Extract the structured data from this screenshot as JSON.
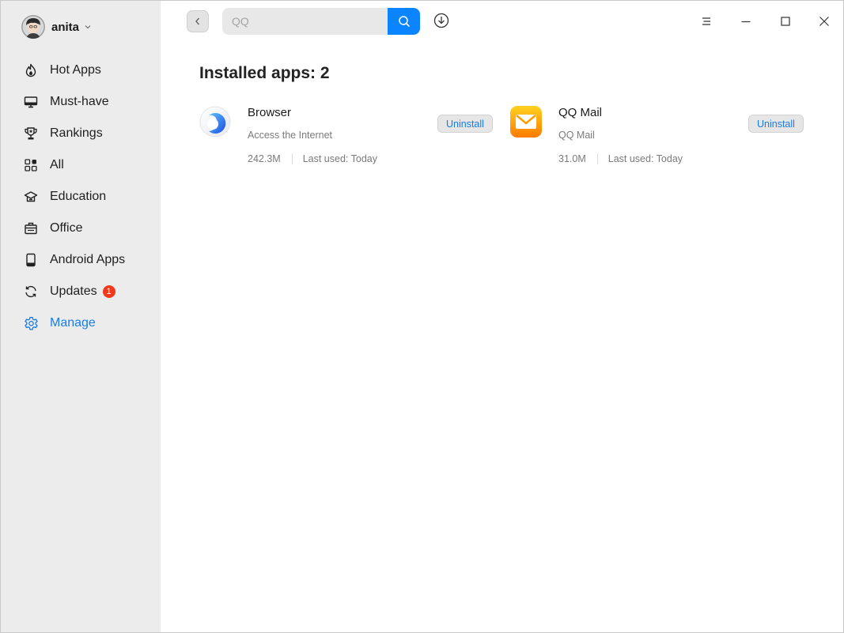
{
  "user": {
    "name": "anita"
  },
  "sidebar": {
    "items": [
      {
        "label": "Hot Apps",
        "icon": "flame-icon"
      },
      {
        "label": "Must-have",
        "icon": "monitor-icon"
      },
      {
        "label": "Rankings",
        "icon": "trophy-icon"
      },
      {
        "label": "All",
        "icon": "grid-icon"
      },
      {
        "label": "Education",
        "icon": "graduation-cap-icon"
      },
      {
        "label": "Office",
        "icon": "briefcase-icon"
      },
      {
        "label": "Android Apps",
        "icon": "phone-icon"
      },
      {
        "label": "Updates",
        "icon": "refresh-icon",
        "badge": "1"
      },
      {
        "label": "Manage",
        "icon": "gear-icon",
        "active": true
      }
    ]
  },
  "search": {
    "value": "",
    "placeholder": "QQ"
  },
  "main": {
    "title": "Installed apps: 2",
    "apps": [
      {
        "name": "Browser",
        "description": "Access the Internet",
        "size": "242.3M",
        "last_used": "Last used: Today",
        "action": "Uninstall"
      },
      {
        "name": "QQ Mail",
        "description": "QQ Mail",
        "size": "31.0M",
        "last_used": "Last used: Today",
        "action": "Uninstall"
      }
    ]
  },
  "colors": {
    "accent": "#0a84ff",
    "active_text": "#1a7ce6",
    "badge": "#f2381a",
    "sidebar_bg": "#ececec"
  }
}
